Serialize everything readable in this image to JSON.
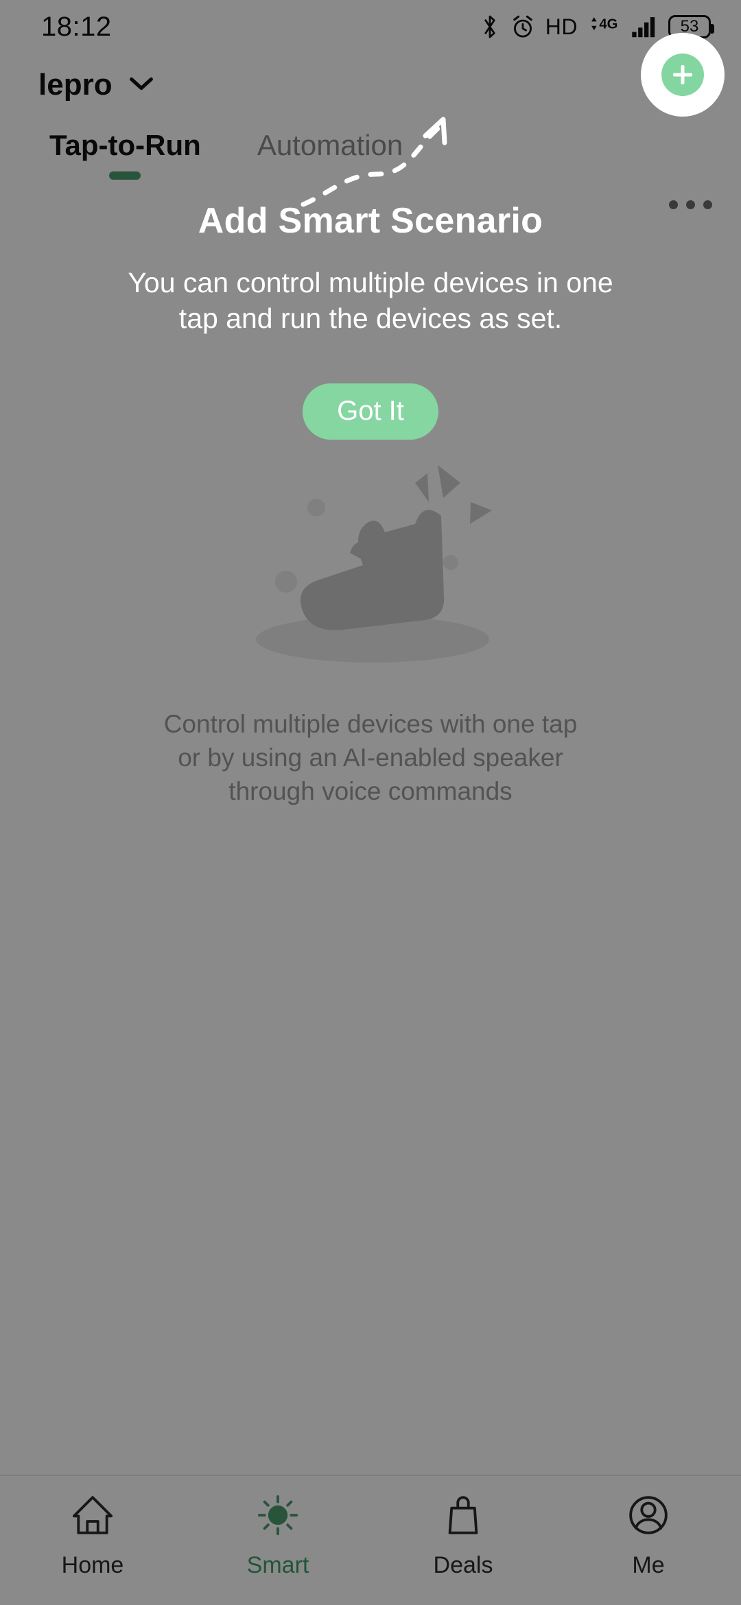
{
  "status_bar": {
    "time": "18:12",
    "battery_percent": "53",
    "network_label": "4G",
    "call_quality_label": "HD",
    "icons": [
      "bluetooth-icon",
      "alarm-icon",
      "hd-icon",
      "mobile-data-icon",
      "signal-icon",
      "battery-icon"
    ]
  },
  "app_bar": {
    "home_name": "lepro",
    "chevron_icon": "chevron-down-icon",
    "add_button_icon": "plus-icon",
    "overflow_icon": "more-options-icon"
  },
  "tabs": [
    {
      "label": "Tap-to-Run",
      "active": true
    },
    {
      "label": "Automation",
      "active": false
    }
  ],
  "empty_state": {
    "illustration": "tap-hand-illustration",
    "hint": "Control multiple devices with one tap or by using an AI-enabled speaker through voice commands"
  },
  "coach_mark": {
    "title": "Add Smart Scenario",
    "description": "You can control multiple devices in one tap and run the devices as set.",
    "button_label": "Got It",
    "arrow_icon": "dashed-arrow-icon"
  },
  "bottom_nav": [
    {
      "label": "Home",
      "icon": "home-icon",
      "active": false
    },
    {
      "label": "Smart",
      "icon": "brightness-icon",
      "active": true
    },
    {
      "label": "Deals",
      "icon": "shopping-bag-icon",
      "active": false
    },
    {
      "label": "Me",
      "icon": "account-icon",
      "active": false
    }
  ],
  "colors": {
    "accent_green": "#4a9c6d",
    "button_green": "#86d6a2",
    "overlay": "rgba(0,0,0,0.46)"
  }
}
